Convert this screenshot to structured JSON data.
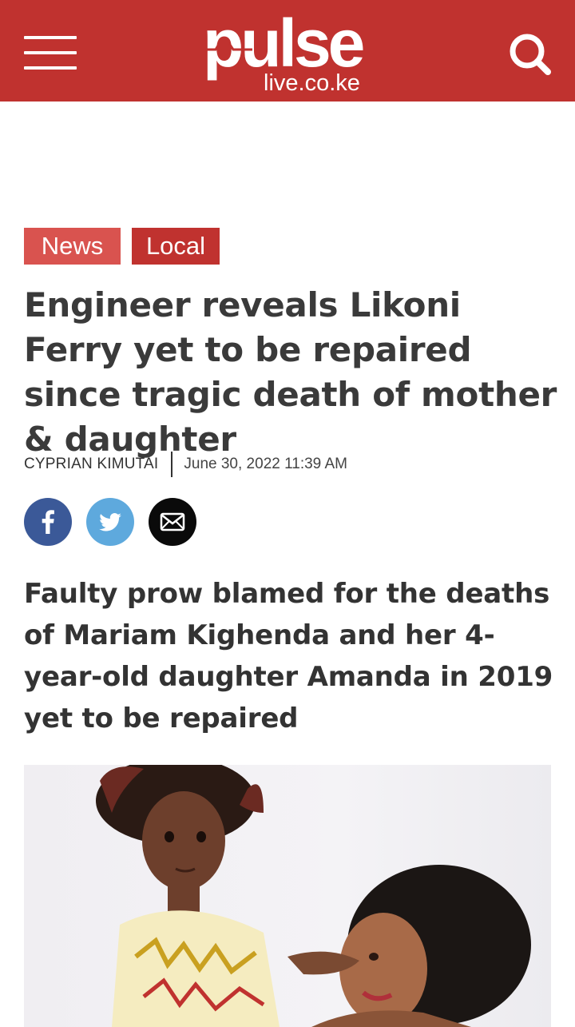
{
  "header": {
    "logo_text": "pulse",
    "logo_domain": "live.co.ke",
    "menu_icon": "hamburger-menu-icon",
    "search_icon": "search-icon",
    "brand_color": "#c0322f"
  },
  "article": {
    "tags": [
      {
        "label": "News",
        "color": "#d9534f"
      },
      {
        "label": "Local",
        "color": "#c0322f"
      }
    ],
    "title": "Engineer reveals Likoni Ferry yet to be repaired since tragic death of mother & daughter",
    "author": "CYPRIAN KIMUTAI",
    "date": "June 30, 2022 11:39 AM",
    "summary": "Faulty prow blamed for the deaths of Mariam Kighenda and her 4-year-old daughter Amanda in 2019 yet to be repaired"
  },
  "share": [
    {
      "icon": "facebook-icon",
      "color": "#3b5998"
    },
    {
      "icon": "twitter-icon",
      "color": "#5ea9dd"
    },
    {
      "icon": "email-icon",
      "color": "#0a0a0a"
    }
  ]
}
